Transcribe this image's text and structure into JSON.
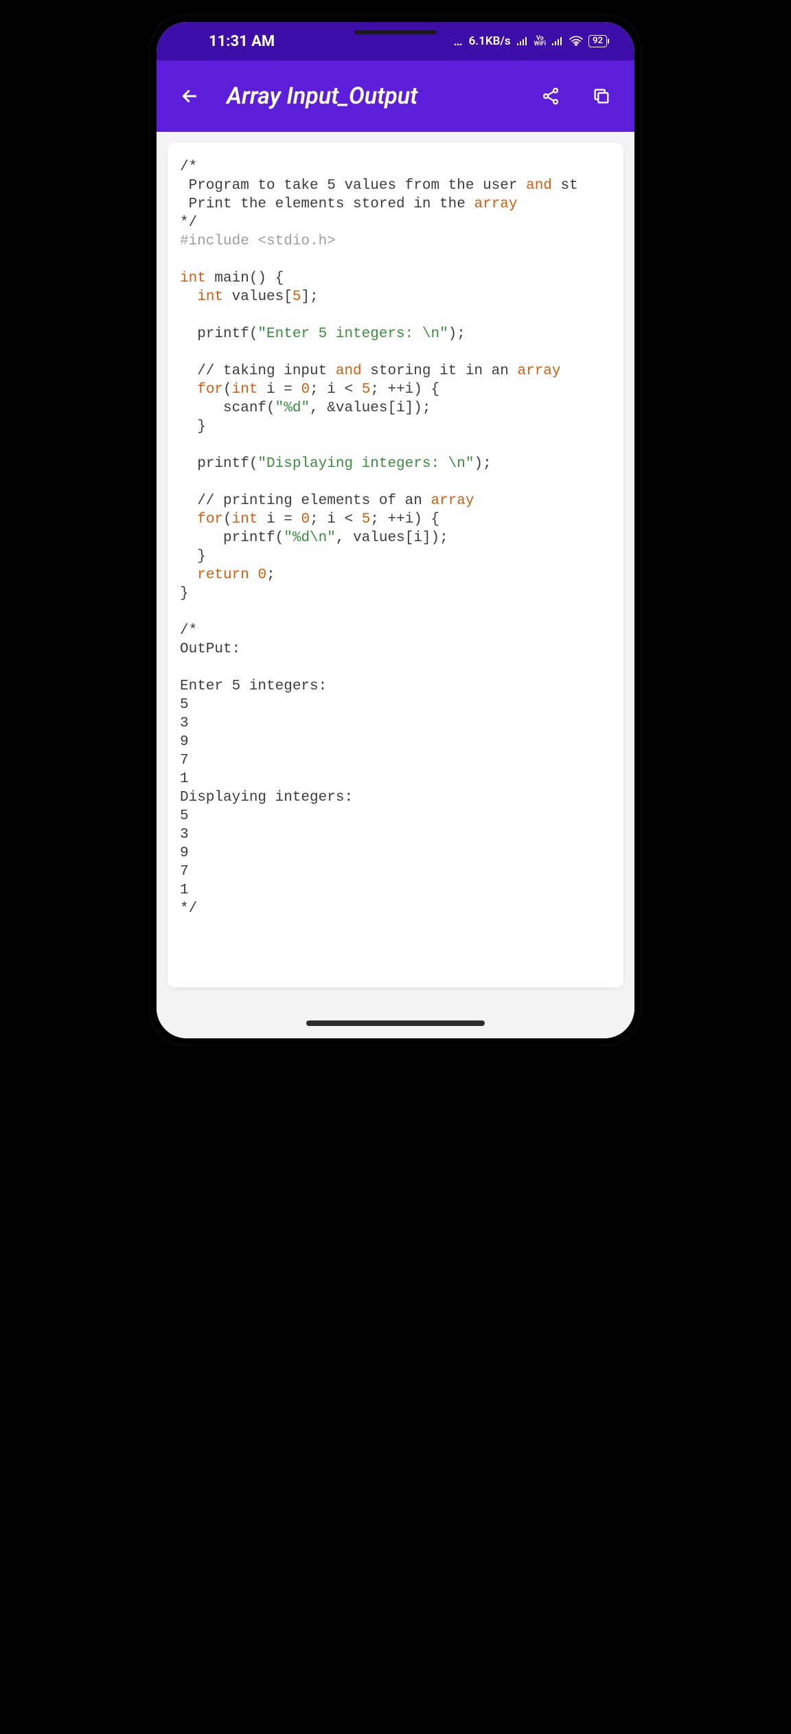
{
  "status": {
    "time": "11:31 AM",
    "net_speed": "6.1KB/s",
    "volte": "Vo",
    "wifi_label": "WiFi",
    "battery": "92"
  },
  "appbar": {
    "title": "Array Input_Output"
  },
  "code": {
    "l1": "/*",
    "l2a": " Program to take 5 values from the user ",
    "l2b": "and",
    "l2c": " st",
    "l3a": " Print the elements stored in the ",
    "l3b": "array",
    "l4": "*/",
    "l5": "#include <stdio.h>",
    "l6a": "int",
    "l6b": " main() {",
    "l7a": "  ",
    "l7b": "int",
    "l7c": " values[",
    "l7d": "5",
    "l7e": "];",
    "l8a": "  printf(",
    "l8b": "\"Enter 5 integers: \\n\"",
    "l8c": ");",
    "l9a": "  // taking input ",
    "l9b": "and",
    "l9c": " storing it in an ",
    "l9d": "array",
    "l10a": "  ",
    "l10b": "for",
    "l10c": "(",
    "l10d": "int",
    "l10e": " i = ",
    "l10f": "0",
    "l10g": "; i < ",
    "l10h": "5",
    "l10i": "; ++i) {",
    "l11a": "     scanf(",
    "l11b": "\"",
    "l11c": "%d",
    "l11d": "\"",
    "l11e": ", &values[i]);",
    "l12": "  }",
    "l13a": "  printf(",
    "l13b": "\"Displaying integers: \\n\"",
    "l13c": ");",
    "l14a": "  // printing elements of an ",
    "l14b": "array",
    "l15a": "  ",
    "l15b": "for",
    "l15c": "(",
    "l15d": "int",
    "l15e": " i = ",
    "l15f": "0",
    "l15g": "; i < ",
    "l15h": "5",
    "l15i": "; ++i) {",
    "l16a": "     printf(",
    "l16b": "\"",
    "l16c": "%d\\n",
    "l16d": "\"",
    "l16e": ", values[i]);",
    "l17": "  }",
    "l18a": "  ",
    "l18b": "return",
    "l18c": " ",
    "l18d": "0",
    "l18e": ";",
    "l19": "}",
    "l20": "/*",
    "l21": "OutPut:",
    "l22": "Enter 5 integers:",
    "l23": "5",
    "l24": "3",
    "l25": "9",
    "l26": "7",
    "l27": "1",
    "l28": "Displaying integers:",
    "l29": "5",
    "l30": "3",
    "l31": "9",
    "l32": "7",
    "l33": "1",
    "l34": "*/"
  }
}
